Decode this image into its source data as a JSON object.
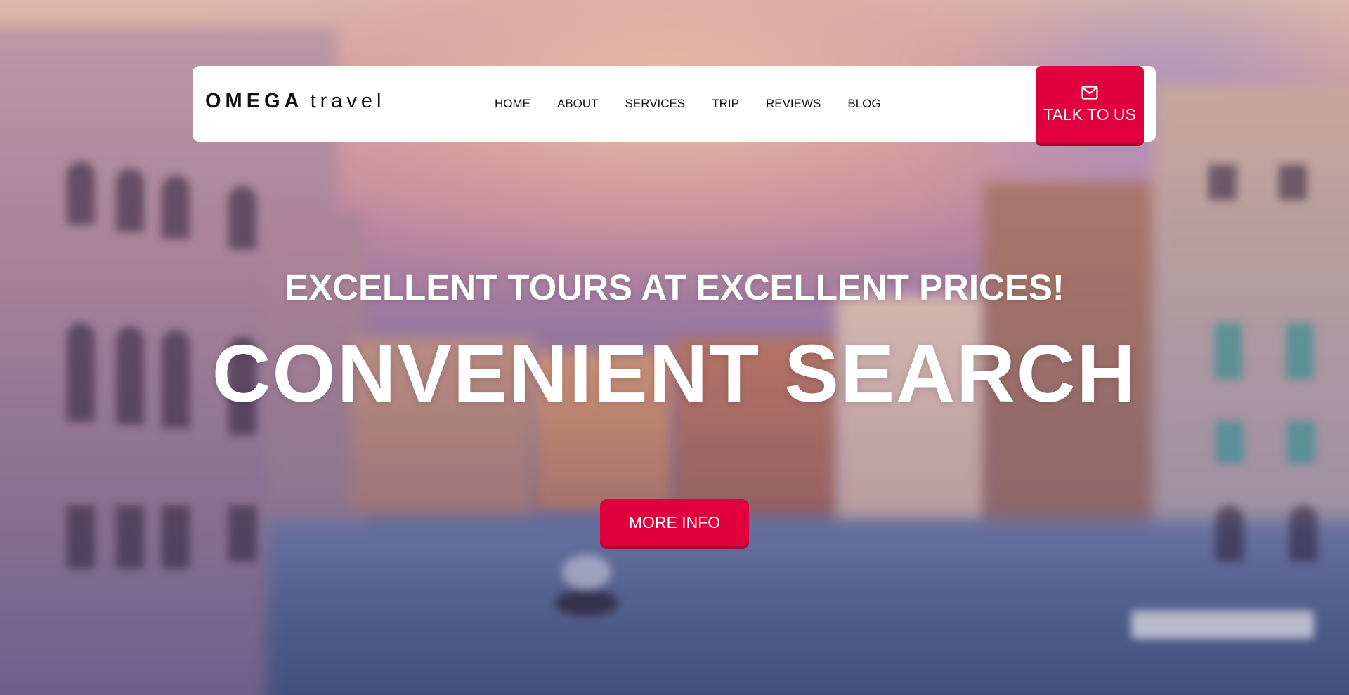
{
  "brand": {
    "name_bold": "OMEGA",
    "name_light": "travel"
  },
  "nav": {
    "items": [
      {
        "label": "HOME"
      },
      {
        "label": "ABOUT"
      },
      {
        "label": "SERVICES"
      },
      {
        "label": "TRIP"
      },
      {
        "label": "REVIEWS"
      },
      {
        "label": "BLOG"
      }
    ]
  },
  "cta": {
    "talk_label": "TALK TO US",
    "talk_icon": "envelope-icon",
    "more_label": "MORE INFO"
  },
  "hero": {
    "subtitle": "EXCELLENT TOURS AT EXCELLENT PRICES!",
    "title": "CONVENIENT SEARCH"
  },
  "colors": {
    "accent": "#e0003d",
    "header_bg": "#ffffff",
    "hero_text": "#ffffff"
  }
}
